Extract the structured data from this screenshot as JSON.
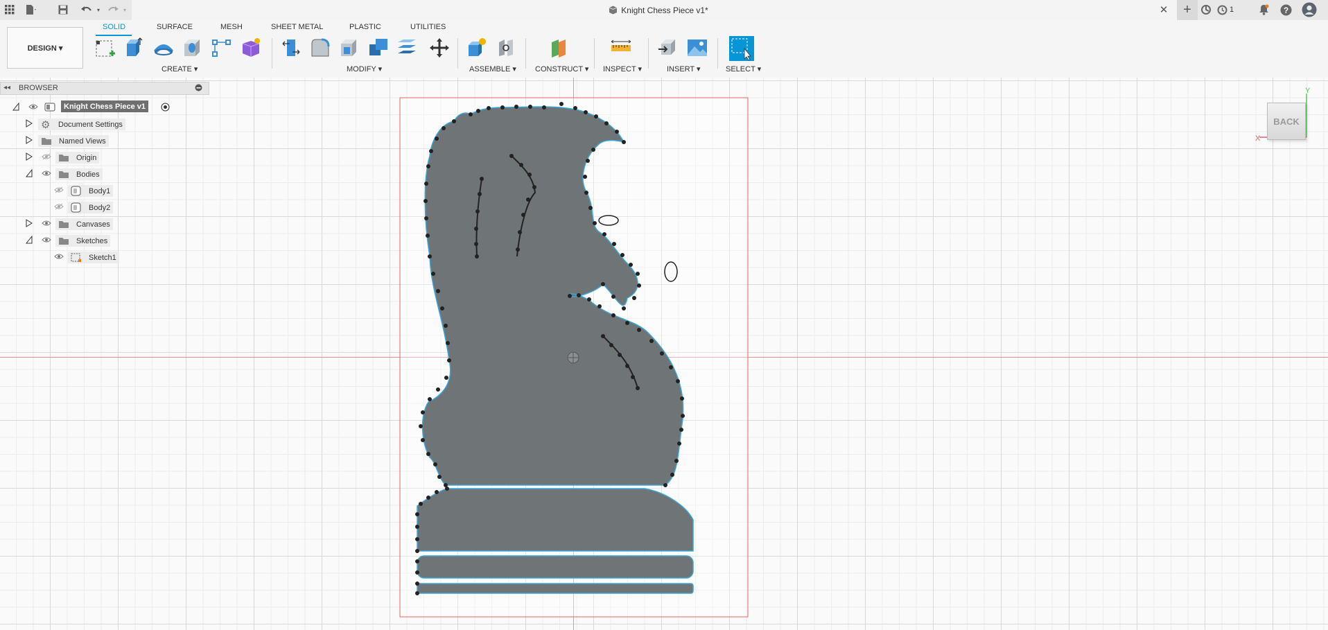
{
  "app": {
    "document_title": "Knight Chess Piece v1*",
    "job_count": "1"
  },
  "workspace": {
    "design_label": "DESIGN ▾"
  },
  "tabs": [
    {
      "label": "SOLID",
      "active": true
    },
    {
      "label": "SURFACE",
      "active": false
    },
    {
      "label": "MESH",
      "active": false
    },
    {
      "label": "SHEET METAL",
      "active": false
    },
    {
      "label": "PLASTIC",
      "active": false
    },
    {
      "label": "UTILITIES",
      "active": false
    }
  ],
  "tool_groups": {
    "create": "CREATE ▾",
    "modify": "MODIFY ▾",
    "assemble": "ASSEMBLE ▾",
    "construct": "CONSTRUCT ▾",
    "inspect": "INSPECT ▾",
    "insert": "INSERT ▾",
    "select": "SELECT ▾"
  },
  "browser": {
    "title": "BROWSER",
    "root": "Knight Chess Piece v1",
    "items": [
      {
        "label": "Document Settings"
      },
      {
        "label": "Named Views"
      },
      {
        "label": "Origin"
      },
      {
        "label": "Bodies"
      },
      {
        "label": "Body1"
      },
      {
        "label": "Body2"
      },
      {
        "label": "Canvases"
      },
      {
        "label": "Sketches"
      },
      {
        "label": "Sketch1"
      }
    ]
  },
  "viewcube": {
    "face_label": "BACK",
    "x_axis": "X",
    "y_axis": "Y"
  },
  "colors": {
    "accent": "#0696d7",
    "body_fill": "#6f7477",
    "sketch_outline": "#3aa6d9",
    "canvas_border": "#e06666",
    "point_marker": "#222222"
  }
}
